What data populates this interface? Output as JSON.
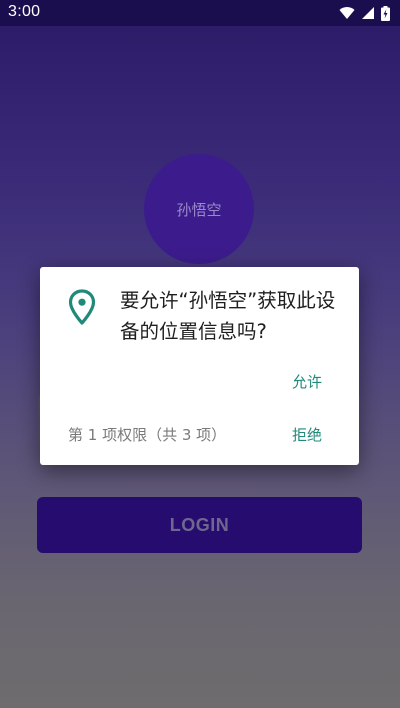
{
  "status_bar": {
    "time": "3:00",
    "icons": [
      "wifi-icon",
      "cellular-signal-icon",
      "battery-charging-icon"
    ]
  },
  "profile": {
    "avatar_name": "孙悟空"
  },
  "login": {
    "button_label": "LOGIN"
  },
  "permission_dialog": {
    "icon": "location-pin-icon",
    "message": "要允许“孙悟空”获取此设备的位置信息吗?",
    "allow_label": "允许",
    "counter": "第 1 项权限（共 3 项）",
    "deny_label": "拒绝"
  },
  "colors": {
    "status_bar": "#1b0e4f",
    "avatar": "#3c1c8c",
    "login_button": "#260c6e",
    "accent": "#20897a"
  }
}
